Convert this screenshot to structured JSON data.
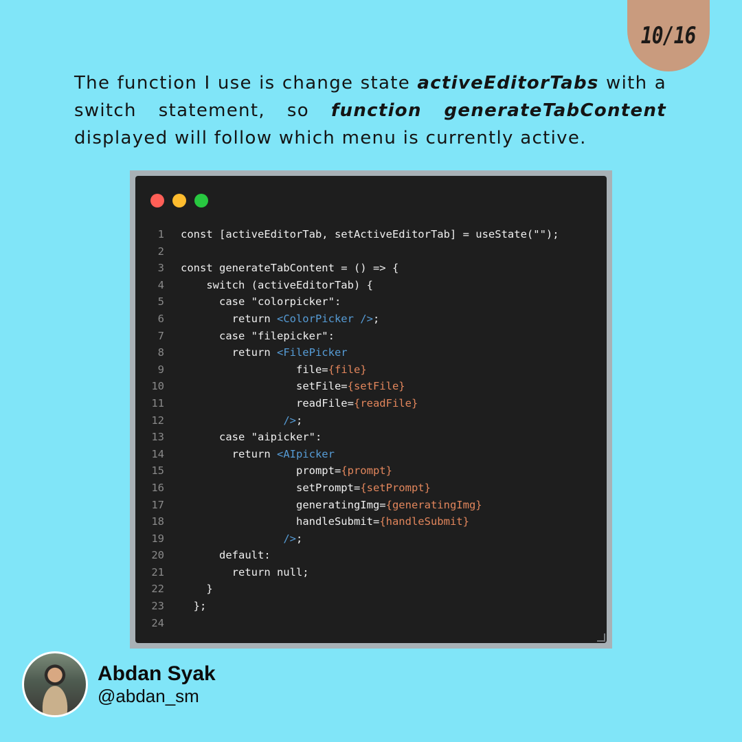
{
  "page": {
    "counter": "10/16"
  },
  "intro": {
    "t1": "The function I use is change state ",
    "b1": "activeEditorTabs",
    "t2": " with a switch statement, so ",
    "b2": "function generateTabContent",
    "t3": " displayed will follow which menu is currently active."
  },
  "code_window": {
    "dots": [
      "red",
      "yellow",
      "green"
    ],
    "lines": [
      {
        "n": "1",
        "indent": "",
        "segs": [
          [
            "t",
            "const [activeEditorTab, setActiveEditorTab] = useState(\"\");"
          ]
        ]
      },
      {
        "n": "2",
        "indent": "",
        "segs": []
      },
      {
        "n": "3",
        "indent": "",
        "segs": [
          [
            "t",
            "const generateTabContent = () => {"
          ]
        ]
      },
      {
        "n": "4",
        "indent": "    ",
        "segs": [
          [
            "t",
            "switch (activeEditorTab) {"
          ]
        ]
      },
      {
        "n": "5",
        "indent": "      ",
        "segs": [
          [
            "t",
            "case \"colorpicker\":"
          ]
        ]
      },
      {
        "n": "6",
        "indent": "        ",
        "segs": [
          [
            "t",
            "return "
          ],
          [
            "tag",
            "<ColorPicker />"
          ],
          [
            "t",
            ";"
          ]
        ]
      },
      {
        "n": "7",
        "indent": "      ",
        "segs": [
          [
            "t",
            "case \"filepicker\":"
          ]
        ]
      },
      {
        "n": "8",
        "indent": "        ",
        "segs": [
          [
            "t",
            "return "
          ],
          [
            "tag",
            "<FilePicker"
          ]
        ]
      },
      {
        "n": "9",
        "indent": "                  ",
        "segs": [
          [
            "t",
            "file="
          ],
          [
            "brk",
            "{file}"
          ]
        ]
      },
      {
        "n": "10",
        "indent": "                  ",
        "segs": [
          [
            "t",
            "setFile="
          ],
          [
            "brk",
            "{setFile}"
          ]
        ]
      },
      {
        "n": "11",
        "indent": "                  ",
        "segs": [
          [
            "t",
            "readFile="
          ],
          [
            "brk",
            "{readFile}"
          ]
        ]
      },
      {
        "n": "12",
        "indent": "                ",
        "segs": [
          [
            "tag",
            "/>"
          ],
          [
            "t",
            ";"
          ]
        ]
      },
      {
        "n": "13",
        "indent": "      ",
        "segs": [
          [
            "t",
            "case \"aipicker\":"
          ]
        ]
      },
      {
        "n": "14",
        "indent": "        ",
        "segs": [
          [
            "t",
            "return "
          ],
          [
            "tag",
            "<AIpicker"
          ]
        ]
      },
      {
        "n": "15",
        "indent": "                  ",
        "segs": [
          [
            "t",
            "prompt="
          ],
          [
            "brk",
            "{prompt}"
          ]
        ]
      },
      {
        "n": "16",
        "indent": "                  ",
        "segs": [
          [
            "t",
            "setPrompt="
          ],
          [
            "brk",
            "{setPrompt}"
          ]
        ]
      },
      {
        "n": "17",
        "indent": "                  ",
        "segs": [
          [
            "t",
            "generatingImg="
          ],
          [
            "brk",
            "{generatingImg}"
          ]
        ]
      },
      {
        "n": "18",
        "indent": "                  ",
        "segs": [
          [
            "t",
            "handleSubmit="
          ],
          [
            "brk",
            "{handleSubmit}"
          ]
        ]
      },
      {
        "n": "19",
        "indent": "                ",
        "segs": [
          [
            "tag",
            "/>"
          ],
          [
            "t",
            ";"
          ]
        ]
      },
      {
        "n": "20",
        "indent": "      ",
        "segs": [
          [
            "t",
            "default:"
          ]
        ]
      },
      {
        "n": "21",
        "indent": "        ",
        "segs": [
          [
            "t",
            "return null;"
          ]
        ]
      },
      {
        "n": "22",
        "indent": "    ",
        "segs": [
          [
            "t",
            "}"
          ]
        ]
      },
      {
        "n": "23",
        "indent": "  ",
        "segs": [
          [
            "t",
            "};"
          ]
        ]
      },
      {
        "n": "24",
        "indent": "",
        "segs": []
      }
    ]
  },
  "author": {
    "name": "Abdan Syak",
    "handle": "@abdan_sm"
  },
  "colors": {
    "background": "#80e5f8",
    "badge": "#c99b7e",
    "tag": "#569cd6",
    "brace": "#e2865c"
  }
}
